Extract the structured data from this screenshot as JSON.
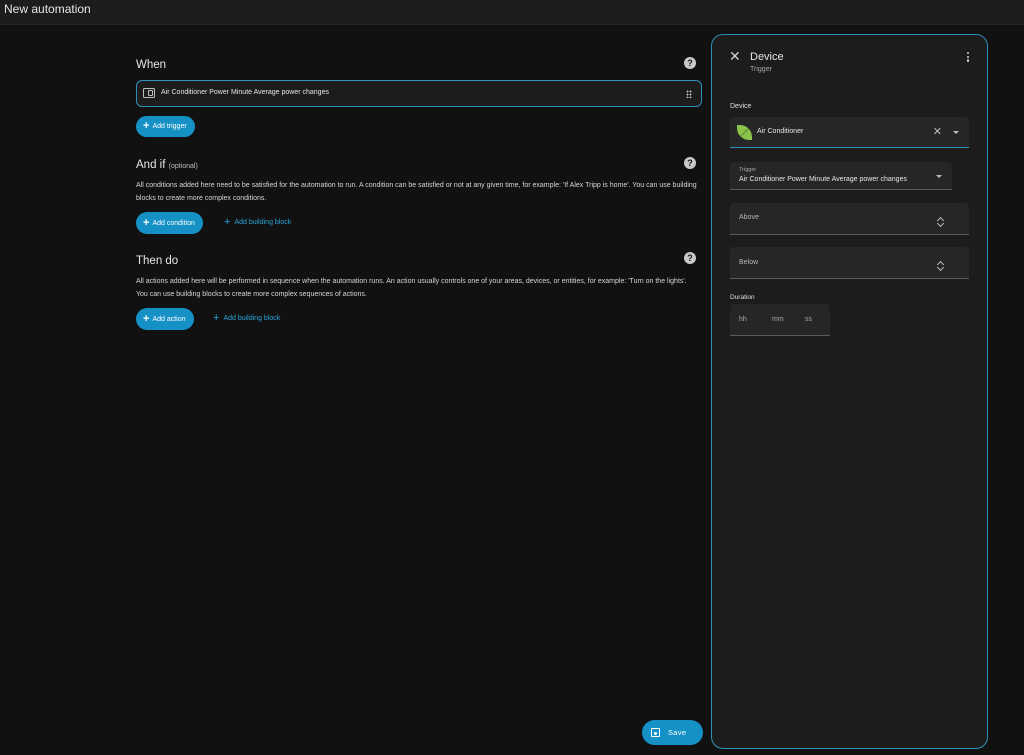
{
  "app": {
    "title": "New automation"
  },
  "when": {
    "heading": "When",
    "trigger_label": "Air Conditioner Power Minute Average power changes",
    "add_trigger": "Add trigger"
  },
  "and_if": {
    "heading": "And if",
    "optional": "(optional)",
    "description": "All conditions added here need to be satisfied for the automation to run. A condition can be satisfied or not at any given time, for example: 'If Alex Tripp is home'. You can use building blocks to create more complex conditions.",
    "add_condition": "Add condition",
    "add_building_block": "Add building block"
  },
  "then_do": {
    "heading": "Then do",
    "description": "All actions added here will be performed in sequence when the automation runs. An action usually controls one of your areas, devices, or entities, for example: 'Turn on the lights'. You can use building blocks to create more complex sequences of actions.",
    "add_action": "Add action",
    "add_building_block": "Add building block"
  },
  "save_label": "Save",
  "panel": {
    "title": "Device",
    "subtitle": "Trigger",
    "device_label": "Device",
    "device_value": "Air Conditioner",
    "trigger_small_label": "Trigger",
    "trigger_value": "Air Conditioner Power Minute Average power changes",
    "above_placeholder": "Above",
    "below_placeholder": "Below",
    "duration_label": "Duration",
    "duration": {
      "hh": "hh",
      "mm": "mm",
      "ss": "ss"
    }
  },
  "colors": {
    "accent": "#1591c6",
    "border_accent": "#2e90b8",
    "background": "#111111",
    "panel": "#1c1c1c"
  }
}
